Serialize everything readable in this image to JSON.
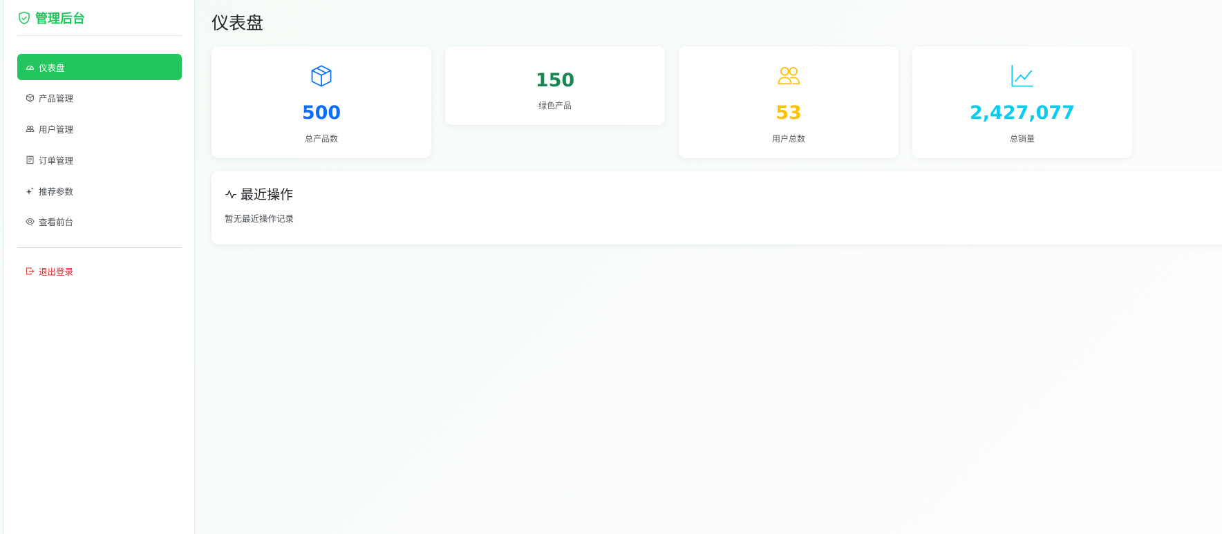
{
  "brand": {
    "title": "管理后台",
    "icon": "shield-check-icon",
    "color": "#22c55e"
  },
  "sidebar": {
    "items": [
      {
        "label": "仪表盘",
        "icon": "speedometer-icon",
        "active": true
      },
      {
        "label": "产品管理",
        "icon": "box-icon",
        "active": false
      },
      {
        "label": "用户管理",
        "icon": "people-icon",
        "active": false
      },
      {
        "label": "订单管理",
        "icon": "receipt-icon",
        "active": false
      },
      {
        "label": "推荐参数",
        "icon": "stars-icon",
        "active": false
      },
      {
        "label": "查看前台",
        "icon": "eye-icon",
        "active": false
      }
    ],
    "logout": {
      "label": "退出登录",
      "icon": "box-arrow-right-icon",
      "color": "#dc2626"
    }
  },
  "main": {
    "title": "仪表盘",
    "stats": [
      {
        "value": "500",
        "label": "总产品数",
        "icon": "box-icon",
        "color": "#0d6efd"
      },
      {
        "value": "150",
        "label": "绿色产品",
        "icon": "",
        "color": "#198754"
      },
      {
        "value": "53",
        "label": "用户总数",
        "icon": "people-icon",
        "color": "#ffc107"
      },
      {
        "value": "2,427,077",
        "label": "总销量",
        "icon": "graph-up-icon",
        "color": "#0dcaf0"
      }
    ],
    "recent": {
      "title": "最近操作",
      "icon": "activity-icon",
      "empty_text": "暂无最近操作记录"
    }
  }
}
